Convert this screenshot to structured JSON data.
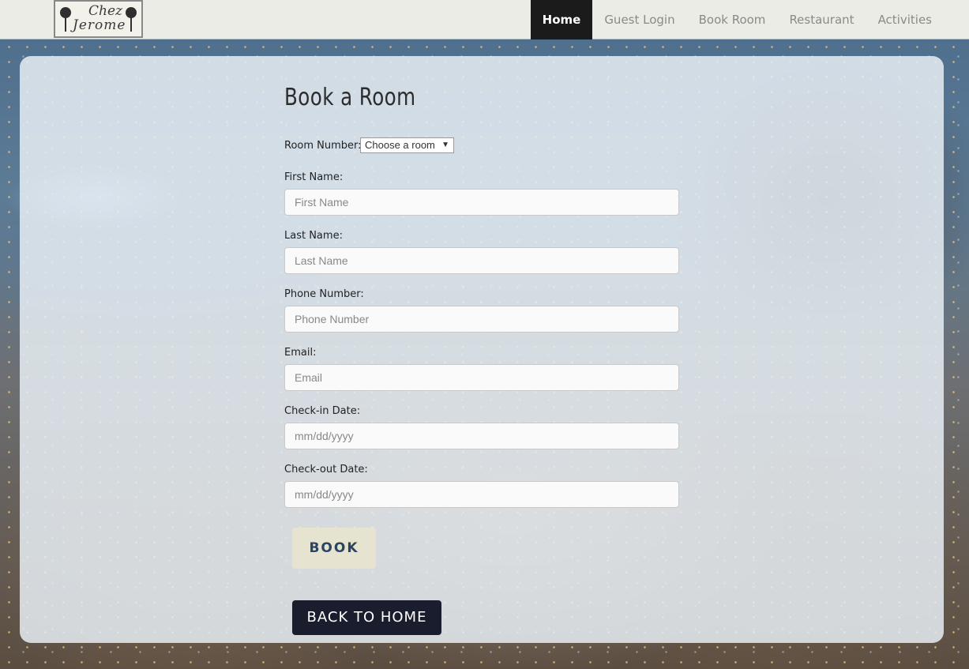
{
  "logo": {
    "line1": "Chez",
    "line2": "Jerome"
  },
  "nav": {
    "items": [
      {
        "label": "Home",
        "active": true
      },
      {
        "label": "Guest Login",
        "active": false
      },
      {
        "label": "Book Room",
        "active": false
      },
      {
        "label": "Restaurant",
        "active": false
      },
      {
        "label": "Activities",
        "active": false
      }
    ]
  },
  "form": {
    "title": "Book a Room",
    "room_number": {
      "label": "Room Number:",
      "selected": "Choose a room"
    },
    "first_name": {
      "label": "First Name:",
      "placeholder": "First Name"
    },
    "last_name": {
      "label": "Last Name:",
      "placeholder": "Last Name"
    },
    "phone": {
      "label": "Phone Number:",
      "placeholder": "Phone Number"
    },
    "email": {
      "label": "Email:",
      "placeholder": "Email"
    },
    "checkin": {
      "label": "Check-in Date:",
      "placeholder": "mm/dd/yyyy"
    },
    "checkout": {
      "label": "Check-out Date:",
      "placeholder": "mm/dd/yyyy"
    },
    "book_button": "BOOK",
    "back_button": "BACK TO HOME"
  },
  "colors": {
    "navbar_bg": "#ecece6",
    "nav_active_bg": "#1b1b1b",
    "book_button_bg": "#e6e4d0",
    "book_button_text": "#2b4460",
    "back_button_bg": "#1a1d2e"
  }
}
